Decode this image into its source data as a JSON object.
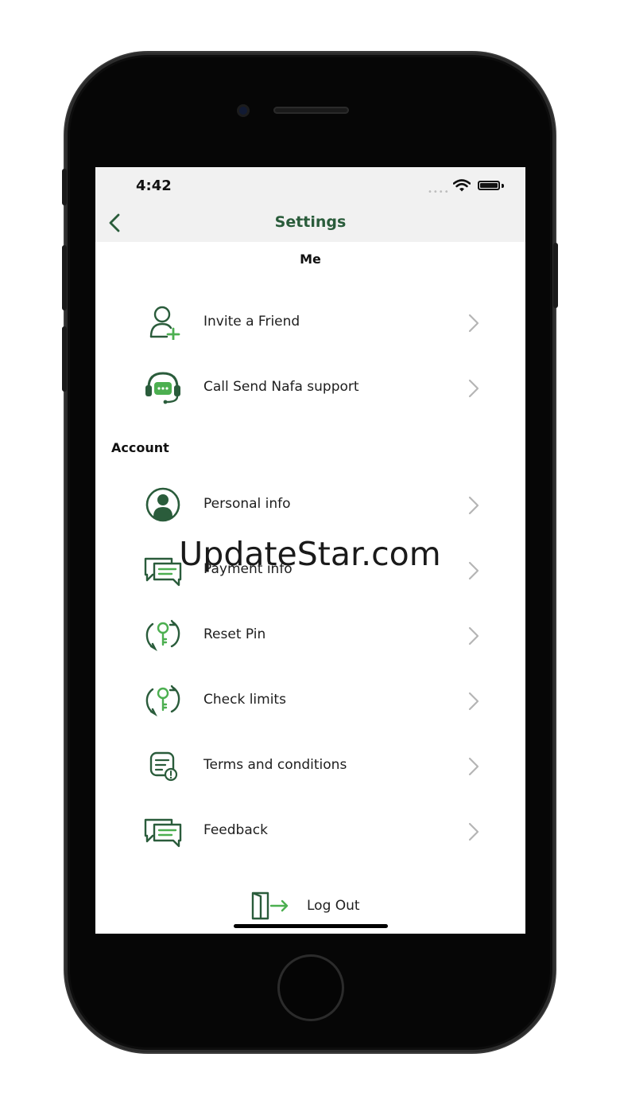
{
  "status_bar": {
    "time": "4:42",
    "signal_dots": "••••"
  },
  "header": {
    "title": "Settings"
  },
  "sections": {
    "me": "Me",
    "account": "Account"
  },
  "me_items": [
    {
      "label": "Invite a Friend",
      "icon": "add-user-icon"
    },
    {
      "label": "Call Send Nafa support",
      "icon": "headset-support-icon"
    }
  ],
  "account_items": [
    {
      "label": "Personal info",
      "icon": "user-avatar-icon"
    },
    {
      "label": "Payment info",
      "icon": "chat-bubbles-icon"
    },
    {
      "label": "Reset Pin",
      "icon": "key-refresh-icon"
    },
    {
      "label": "Check limits",
      "icon": "key-refresh-icon"
    },
    {
      "label": "Terms and conditions",
      "icon": "document-info-icon"
    },
    {
      "label": "Feedback",
      "icon": "chat-bubbles-icon"
    }
  ],
  "logout": {
    "label": "Log Out",
    "icon": "exit-door-icon"
  },
  "watermark": "UpdateStar.com",
  "colors": {
    "brand_green": "#2a5c3b",
    "accent_green": "#4caf50",
    "chevron": "#b5b5b5",
    "nav_bg": "#f1f1f1"
  }
}
